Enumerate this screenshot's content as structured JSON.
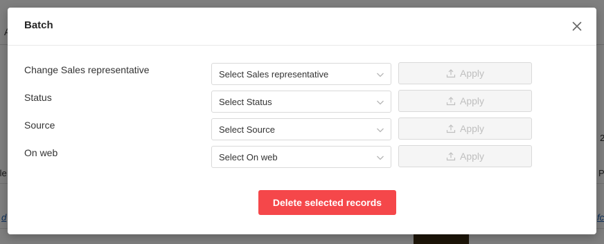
{
  "background": {
    "letter": "A",
    "frag_2": "2",
    "frag_tle": "tle",
    "frag_p": "P",
    "frag_d": "d",
    "frag_fc": "fc"
  },
  "modal": {
    "title": "Batch",
    "rows": [
      {
        "label": "Change Sales representative",
        "placeholder": "Select Sales representative",
        "apply": "Apply"
      },
      {
        "label": "Status",
        "placeholder": "Select Status",
        "apply": "Apply"
      },
      {
        "label": "Source",
        "placeholder": "Select Source",
        "apply": "Apply"
      },
      {
        "label": "On web",
        "placeholder": "Select On web",
        "apply": "Apply"
      }
    ],
    "delete_label": "Delete selected records",
    "colors": {
      "danger": "#f5474a",
      "disabled_text": "#bfbfbf",
      "disabled_bg": "#f5f5f5"
    }
  }
}
